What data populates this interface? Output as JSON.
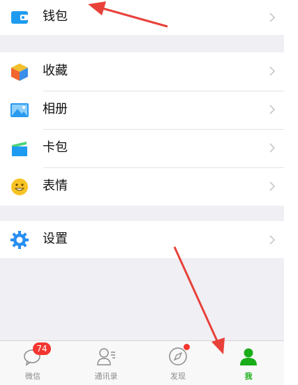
{
  "menu": {
    "wallet": {
      "label": "钱包",
      "icon": "wallet-icon"
    },
    "favorites": {
      "label": "收藏",
      "icon": "favorites-cube-icon"
    },
    "album": {
      "label": "相册",
      "icon": "photo-icon"
    },
    "cards": {
      "label": "卡包",
      "icon": "card-holder-icon"
    },
    "stickers": {
      "label": "表情",
      "icon": "smiley-icon"
    },
    "settings": {
      "label": "设置",
      "icon": "gear-icon"
    }
  },
  "tabbar": {
    "chats": {
      "label": "微信",
      "badge": "74",
      "icon": "chat-bubble-icon"
    },
    "contacts": {
      "label": "通讯录",
      "icon": "contacts-icon"
    },
    "discover": {
      "label": "发现",
      "icon": "compass-icon"
    },
    "me": {
      "label": "我",
      "icon": "me-person-icon"
    }
  },
  "colors": {
    "background": "#efeff4",
    "accent_green": "#1aad19",
    "badge_red": "#f43530",
    "icon_blue": "#1e9bf0",
    "annotation_arrow": "#e8413a"
  }
}
